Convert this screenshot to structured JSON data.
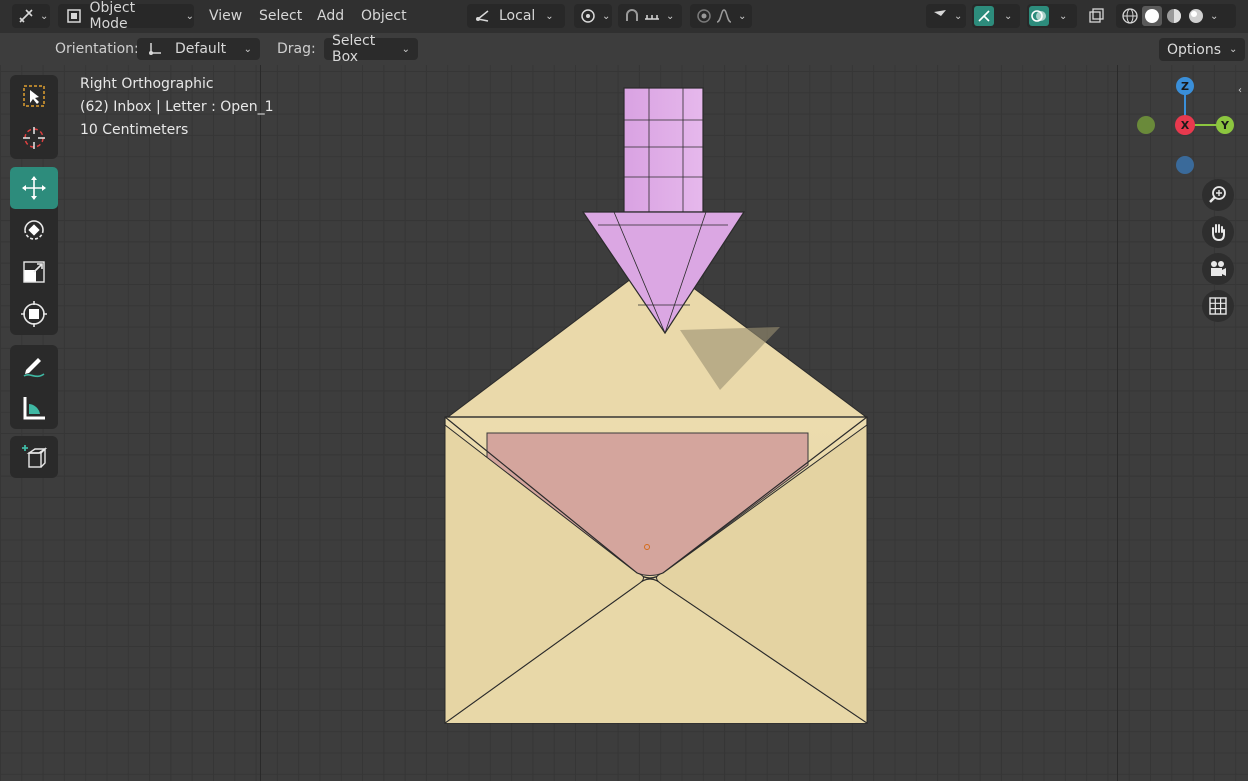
{
  "header": {
    "mode_label": "Object Mode",
    "menus": [
      "View",
      "Select",
      "Add",
      "Object"
    ],
    "transform_orientation": "Local"
  },
  "tool_settings": {
    "orientation_label": "Orientation:",
    "orientation_value": "Default",
    "drag_label": "Drag:",
    "drag_value": "Select Box",
    "options_label": "Options"
  },
  "viewport_info": {
    "view_name": "Right Orthographic",
    "object_info": "(62) Inbox | Letter : Open_1",
    "scale": "10 Centimeters"
  },
  "gizmo": {
    "z": "Z",
    "x": "X",
    "y": "Y"
  },
  "colors": {
    "accent": "#2d8c7c",
    "envelope": "#e6d6a6",
    "letter": "#d4a59d",
    "arrow": "#dca8e4",
    "axis_x": "#e8394e",
    "axis_y": "#8cc63f",
    "axis_z": "#3a8fd9"
  }
}
